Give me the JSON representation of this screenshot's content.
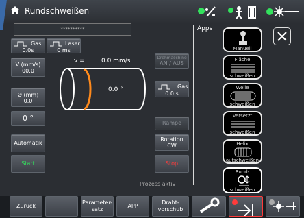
{
  "title": "Rundschweißen",
  "top_field": "**********",
  "gas_label": "Gas",
  "gas_value": "0.0s",
  "laser_label": "Laser",
  "laser_value": "0 ms",
  "speed_label": "V (mm/s)",
  "speed_value": "00.0",
  "diameter_label": "Ø (mm)",
  "diameter_value": "0.0",
  "angle_value": "0 °",
  "automatik": "Automatik",
  "start": "Start",
  "v_equals": "v =",
  "v_value": "0.0 mm/s",
  "cyl_angle": "0.0 °",
  "drehmaschine_line1": "Drehmaschine",
  "drehmaschine_line2": "AN / AUS",
  "gas_right_label": "Gas",
  "gas_right_value": "0.0 s",
  "rampe": "Rampe",
  "rotation_label": "Rotation",
  "rotation_value": "CW",
  "stop": "Stop",
  "status": "Prozess aktiv",
  "apps_title": "Apps",
  "apps": [
    {
      "top": "",
      "bottom": "Manuell"
    },
    {
      "top": "Fläche",
      "bottom": "schweißen"
    },
    {
      "top": "Welle",
      "bottom": "schweißen"
    },
    {
      "top": "Versetzt",
      "bottom": "schweißen"
    },
    {
      "top": "Helix",
      "bottom": "aufschweißen"
    },
    {
      "top": "Rund-",
      "bottom": "schweißen"
    }
  ],
  "bottom": {
    "zurueck": "Zurück",
    "param_line1": "Parameter-",
    "param_line2": "satz",
    "app": "APP",
    "draht_line1": "Draht-",
    "draht_line2": "vorschub"
  },
  "colors": {
    "green": "#33e25d",
    "red": "#ff3b3b",
    "orange": "#ff8a1c",
    "accent": "#e0e0e0"
  }
}
